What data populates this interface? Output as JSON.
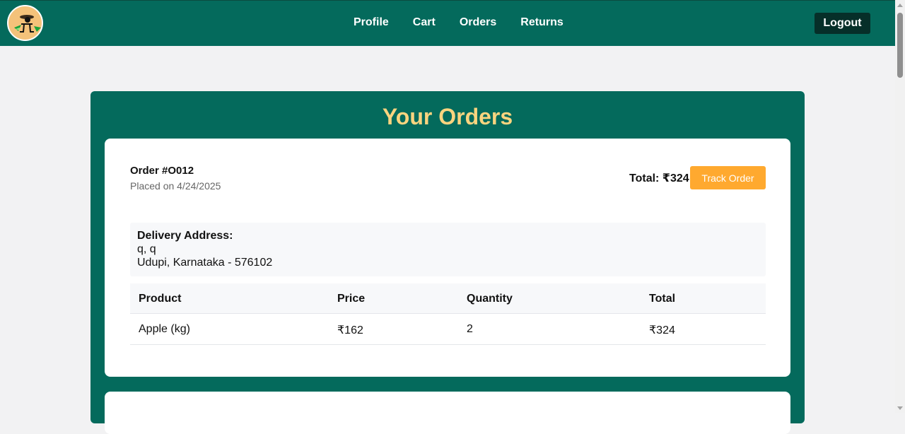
{
  "nav": {
    "links": [
      "Profile",
      "Cart",
      "Orders",
      "Returns"
    ],
    "logout_label": "Logout"
  },
  "page": {
    "title": "Your Orders"
  },
  "orders": [
    {
      "id_label": "Order #O012",
      "placed_label": "Placed on 4/24/2025",
      "total_label": "Total: ₹324",
      "track_label": "Track Order",
      "address": {
        "label": "Delivery Address:",
        "line1": "q, q",
        "line2": "Udupi, Karnataka - 576102"
      },
      "table": {
        "headers": [
          "Product",
          "Price",
          "Quantity",
          "Total"
        ],
        "rows": [
          [
            "Apple (kg)",
            "₹162",
            "2",
            "₹324"
          ]
        ]
      }
    }
  ],
  "colors": {
    "header_bg": "#046a5c",
    "title": "#fad47f",
    "track_button": "#ffa92f",
    "logout_bg": "#062f29"
  }
}
